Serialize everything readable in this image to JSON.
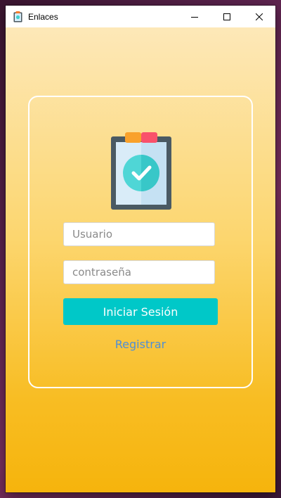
{
  "window": {
    "title": "Enlaces",
    "controls": {
      "minimize": "minimize-icon",
      "maximize": "maximize-icon",
      "close": "close-icon"
    }
  },
  "login": {
    "logo_icon": "clipboard-check-icon",
    "username_placeholder": "Usuario",
    "username_value": "",
    "password_placeholder": "contraseña",
    "password_value": "",
    "submit_label": "Iniciar Sesión",
    "register_label": "Registrar"
  },
  "colors": {
    "button": "#00c8c8",
    "link": "#4f8fd6",
    "gradient_top": "#fde8b8",
    "gradient_bottom": "#f6b40c",
    "card_border": "#ffffff"
  }
}
